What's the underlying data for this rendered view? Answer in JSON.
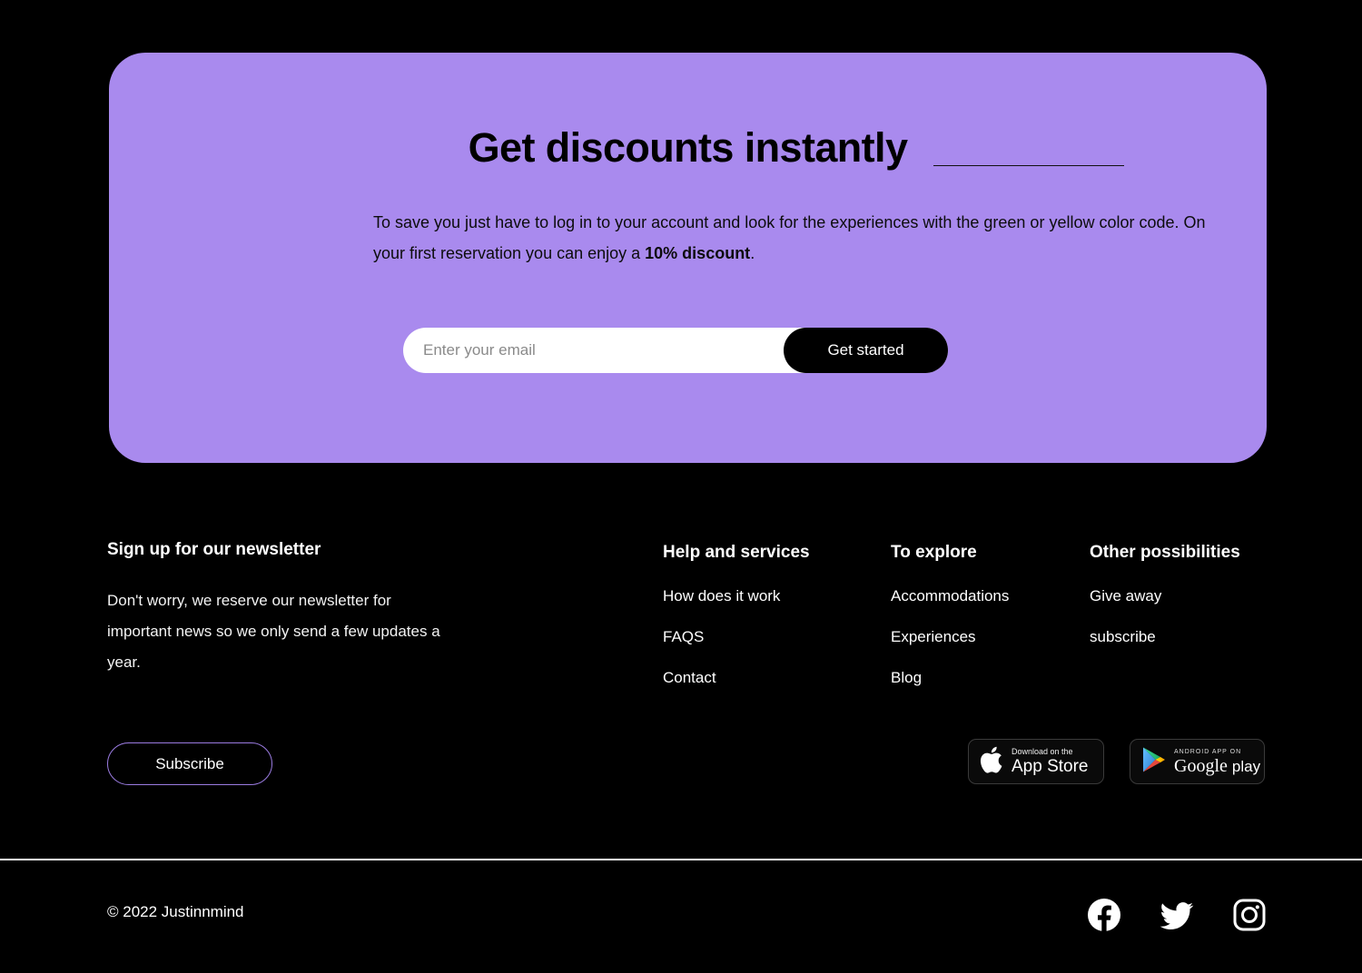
{
  "promo": {
    "title": "Get discounts instantly",
    "body_part1": "To save you just have to log in to your account and look for the experiences with the green or yellow color code. On your first reservation you can enjoy a ",
    "body_strong": "10% discount",
    "body_part2": ".",
    "email_placeholder": "Enter your email",
    "email_value": "",
    "cta_label": "Get started",
    "background_color": "#a98aee"
  },
  "footer": {
    "newsletter": {
      "title": "Sign up for our newsletter",
      "text": "Don't worry, we reserve our newsletter for important news so we only send a few updates a year.",
      "subscribe_label": "Subscribe",
      "subscribe_border_color": "#9a7be0"
    },
    "columns": [
      {
        "heading": "Help and services",
        "links": [
          "How does it work",
          "FAQS",
          "Contact"
        ]
      },
      {
        "heading": "To explore",
        "links": [
          "Accommodations",
          "Experiences",
          "Blog"
        ]
      },
      {
        "heading": "Other possibilities",
        "links": [
          "Give away",
          "subscribe"
        ]
      }
    ],
    "store_badges": [
      {
        "icon": "apple-icon",
        "small_text": "Download on the",
        "big_text": "App Store"
      },
      {
        "icon": "google-play-icon",
        "small_text": "ANDROID APP ON",
        "big_text": "Google",
        "big_text2": "play"
      }
    ]
  },
  "bottom_bar": {
    "copyright": "© 2022 Justinnmind",
    "socials": [
      "facebook-icon",
      "twitter-icon",
      "instagram-icon"
    ]
  }
}
